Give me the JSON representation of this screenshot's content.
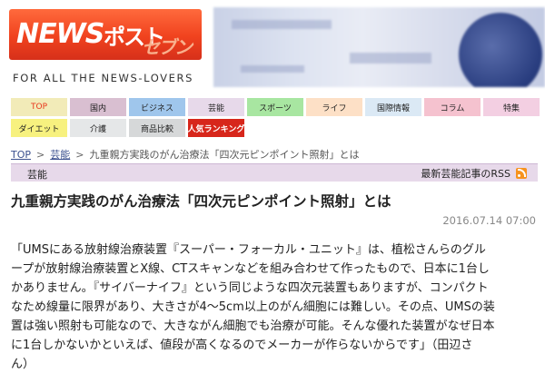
{
  "header": {
    "logo": {
      "news": "NEWS",
      "post": "ポスト",
      "seven": "セブン"
    },
    "tagline": "FOR ALL THE NEWS-LOVERS"
  },
  "nav": {
    "row1": [
      {
        "label": "TOP",
        "color": "#f2ebb8",
        "active": true
      },
      {
        "label": "国内",
        "color": "#d9bfd1"
      },
      {
        "label": "ビジネス",
        "color": "#9fc6ec"
      },
      {
        "label": "芸能",
        "color": "#e7d9ea"
      },
      {
        "label": "スポーツ",
        "color": "#a8e6a1"
      },
      {
        "label": "ライフ",
        "color": "#fde0c6"
      },
      {
        "label": "国際情報",
        "color": "#dbe9f5"
      },
      {
        "label": "コラム",
        "color": "#f5c2cf"
      },
      {
        "label": "特集",
        "color": "#f3cfe2"
      }
    ],
    "row2": [
      {
        "label": "ダイエット",
        "color": "#f7f17f"
      },
      {
        "label": "介護",
        "color": "#e5e7e8"
      },
      {
        "label": "商品比較",
        "color": "#d6d8d9"
      },
      {
        "label": "人気ランキング",
        "color": "#d7261b",
        "ranking": true
      }
    ]
  },
  "breadcrumb": {
    "top": "TOP",
    "category": "芸能",
    "current": "九重親方実践のがん治療法「四次元ピンポイント照射」とは",
    "sep": ">"
  },
  "section": {
    "label": "芸能",
    "rss": "最新芸能記事のRSS"
  },
  "article": {
    "title": "九重親方実践のがん治療法「四次元ピンポイント照射」とは",
    "date": "2016.07.14 07:00",
    "lines": [
      "「UMSにある放射線治療装置『スーパー・フォーカル・ユニット』は、植松さんらのグル",
      "ープが放射線治療装置とX線、CTスキャンなどを組み合わせて作ったもので、日本に1台し",
      "かありません。『サイバーナイフ』という同じような四次元装置もありますが、コンパクト",
      "なため線量に限界があり、大きさが4〜5cm以上のがん細胞には難しい。その点、UMSの装",
      "置は強い照射も可能なので、大きながん細胞でも治療が可能。そんな優れた装置がなぜ日本",
      "に1台しかないかといえば、値段が高くなるのでメーカーが作らないからです」（田辺さ",
      "ん）"
    ]
  }
}
